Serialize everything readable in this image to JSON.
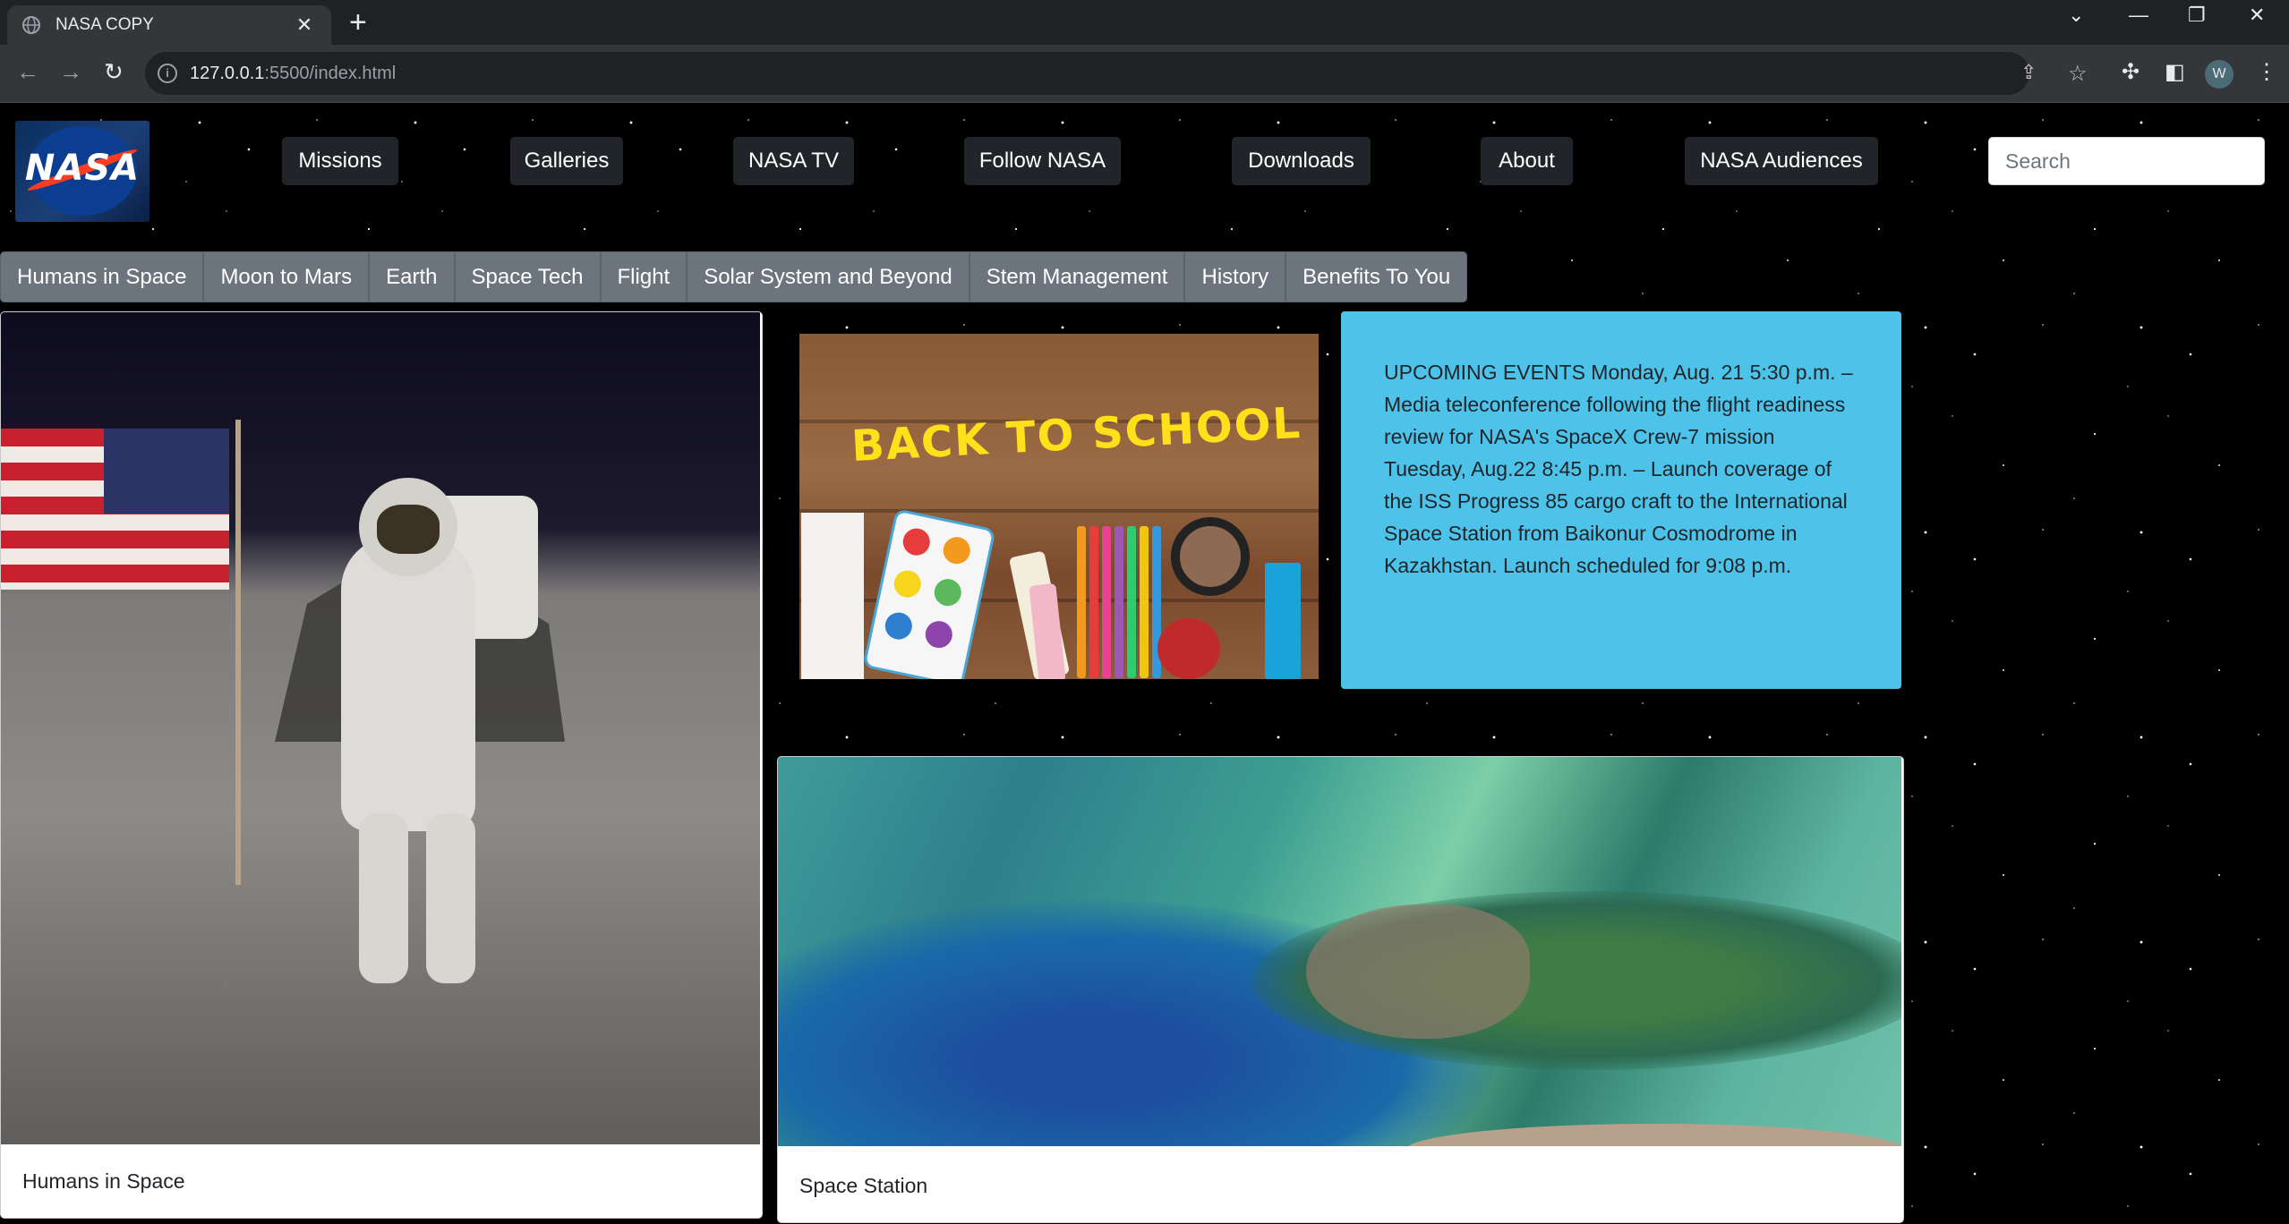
{
  "browser": {
    "tab_title": "NASA COPY",
    "url_host": "127.0.0.1",
    "url_rest": ":5500/index.html",
    "profile_initial": "W"
  },
  "site": {
    "logo_text": "NASA",
    "top_nav": [
      "Missions",
      "Galleries",
      "NASA TV",
      "Follow NASA",
      "Downloads",
      "About",
      "NASA Audiences"
    ],
    "search_placeholder": "Search",
    "categories": [
      "Humans in Space",
      "Moon to Mars",
      "Earth",
      "Space Tech",
      "Flight",
      "Solar System and Beyond",
      "Stem Management",
      "History",
      "Benefits To You"
    ],
    "school_image_text": "BACK TO SCHOOL",
    "events_text": "UPCOMING EVENTS Monday, Aug. 21 5:30 p.m. – Media teleconference following the flight readiness review for NASA's SpaceX Crew-7 mission Tuesday, Aug.22 8:45 p.m. – Launch coverage of the ISS Progress 85 cargo craft to the International Space Station from Baikonur Cosmodrome in Kazakhstan. Launch scheduled for 9:08 p.m.",
    "card_humans_caption": "Humans in Space",
    "card_station_caption": "Space Station"
  },
  "colors": {
    "events_bg": "#4dc3ea",
    "nav_button_bg": "#212529",
    "category_bg": "#6c757d"
  }
}
